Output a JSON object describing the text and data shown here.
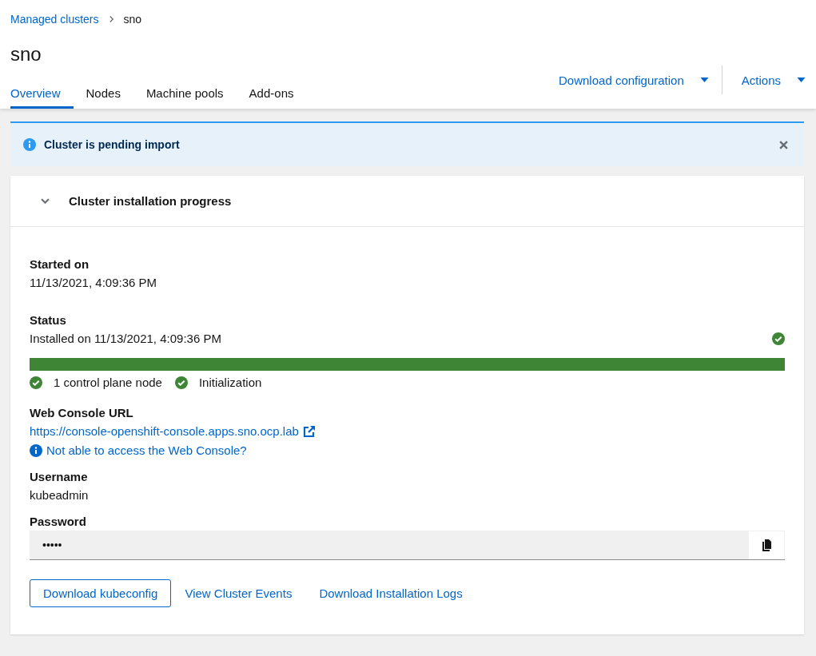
{
  "breadcrumb": [
    {
      "label": "Managed clusters",
      "link": true
    },
    {
      "label": "sno",
      "link": false
    }
  ],
  "title": "sno",
  "tabs": [
    {
      "label": "Overview",
      "selected": true
    },
    {
      "label": "Nodes",
      "selected": false
    },
    {
      "label": "Machine pools",
      "selected": false
    },
    {
      "label": "Add-ons",
      "selected": false
    }
  ],
  "header_actions": [
    "Download configuration",
    "Actions"
  ],
  "alert": {
    "message": "Cluster is pending import"
  },
  "progress_section": {
    "title": "Cluster installation progress",
    "expanded": true,
    "started_label": "Started on",
    "started_value": "11/13/2021, 4:09:36 PM",
    "status_label": "Status",
    "status_value": "Installed on 11/13/2021, 4:09:36 PM",
    "status_done": true,
    "progress": {
      "level": 1
    },
    "steps": [
      {
        "label": "1 control plane node",
        "completed": true
      },
      {
        "label": "Initialization",
        "completed": true
      }
    ],
    "console_label": "Web Console URL",
    "console_url": "https://console-openshift-console.apps.sno.ocp.lab",
    "console_help": "Not able to access the Web Console?",
    "username_label": "Username",
    "username_value": "kubeadmin",
    "password_label": "Password",
    "password_value": "•••••",
    "buttons": [
      {
        "label": "Download kubeconfig",
        "kind": "secondary"
      },
      {
        "label": "View Cluster Events",
        "kind": "link"
      },
      {
        "label": "Download Installation Logs",
        "kind": "link"
      }
    ]
  }
}
